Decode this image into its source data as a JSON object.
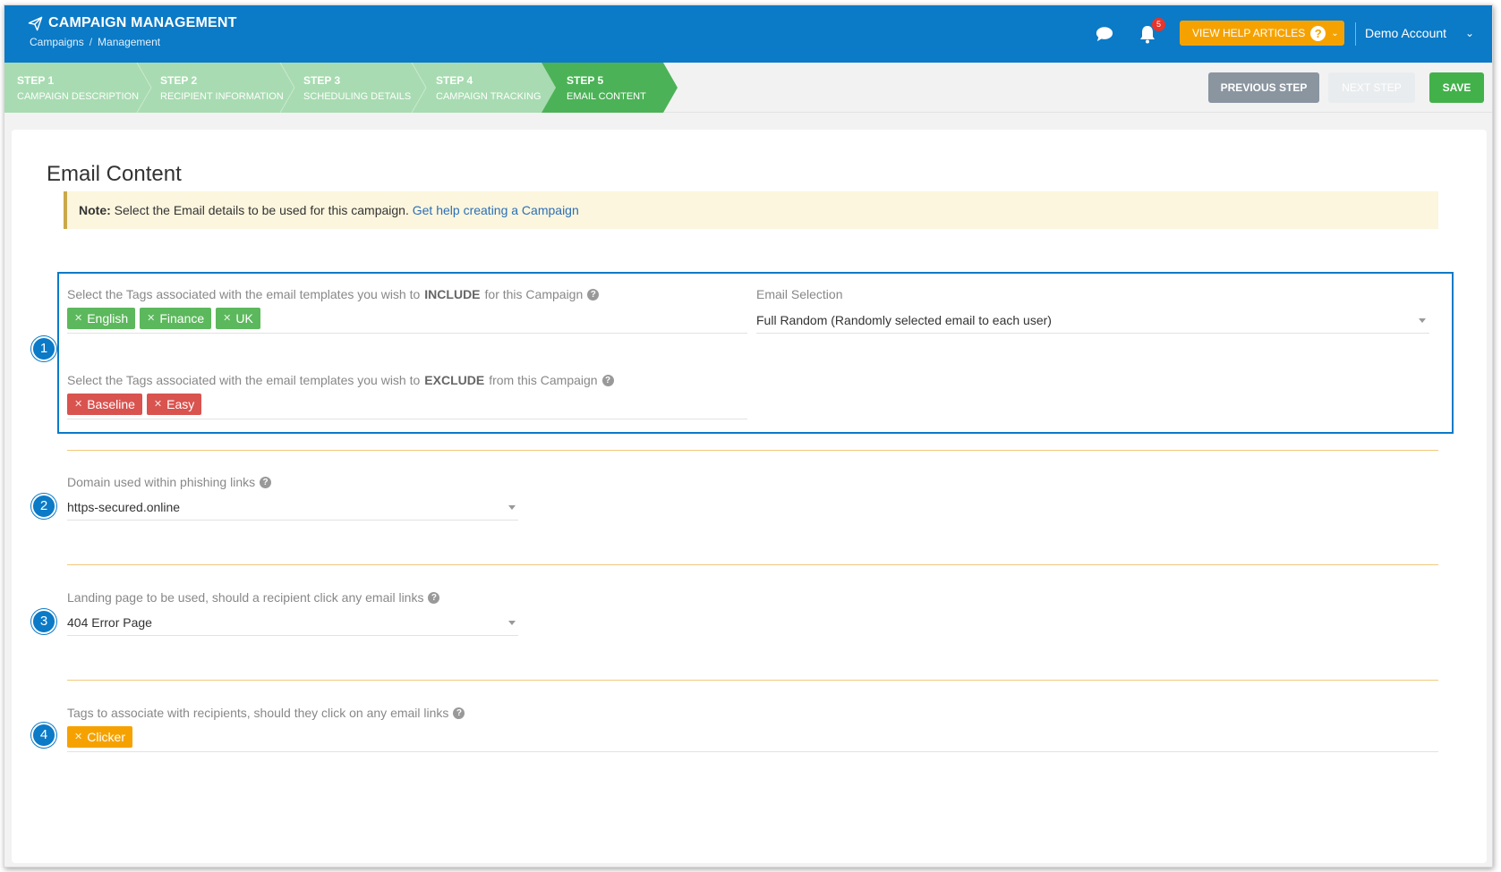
{
  "header": {
    "app_title": "CAMPAIGN MANAGEMENT",
    "breadcrumb": [
      "Campaigns",
      "Management"
    ],
    "breadcrumb_sep": "/",
    "notification_count": "5",
    "help_button": "VIEW HELP ARTICLES",
    "account": "Demo Account"
  },
  "steps": [
    {
      "num": "STEP 1",
      "label": "CAMPAIGN DESCRIPTION",
      "state": "done"
    },
    {
      "num": "STEP 2",
      "label": "RECIPIENT INFORMATION",
      "state": "done"
    },
    {
      "num": "STEP 3",
      "label": "SCHEDULING DETAILS",
      "state": "done"
    },
    {
      "num": "STEP 4",
      "label": "CAMPAIGN TRACKING",
      "state": "done"
    },
    {
      "num": "STEP 5",
      "label": "EMAIL CONTENT",
      "state": "active"
    }
  ],
  "actions": {
    "previous": "PREVIOUS STEP",
    "next": "NEXT STEP",
    "save": "SAVE"
  },
  "page": {
    "title": "Email Content",
    "note_bold": "Note:",
    "note_text": "Select the Email details to be used for this campaign.",
    "note_link": "Get help creating a Campaign"
  },
  "include": {
    "label_pre": "Select the Tags associated with the email templates you wish to",
    "label_bold": "INCLUDE",
    "label_post": "for this Campaign",
    "tags": [
      "English",
      "Finance",
      "UK"
    ]
  },
  "exclude": {
    "label_pre": "Select the Tags associated with the email templates you wish to",
    "label_bold": "EXCLUDE",
    "label_post": "from this Campaign",
    "tags": [
      "Baseline",
      "Easy"
    ]
  },
  "email_selection": {
    "label": "Email Selection",
    "value": "Full Random (Randomly selected email to each user)"
  },
  "domain": {
    "label": "Domain used within phishing links",
    "value": "https-secured.online"
  },
  "landing": {
    "label": "Landing page to be used, should a recipient click any email links",
    "value": "404 Error Page"
  },
  "recipient_tags": {
    "label": "Tags to associate with recipients, should they click on any email links",
    "tags": [
      "Clicker"
    ]
  },
  "markers": [
    "1",
    "2",
    "3",
    "4"
  ],
  "colors": {
    "header_bg": "#0b7ac7",
    "step_done": "#a8dbb1",
    "step_active": "#4cb257",
    "help_orange": "#f5a200",
    "tag_green": "#5cb85c",
    "tag_red": "#d9534f",
    "note_bg": "#fcf6de"
  }
}
